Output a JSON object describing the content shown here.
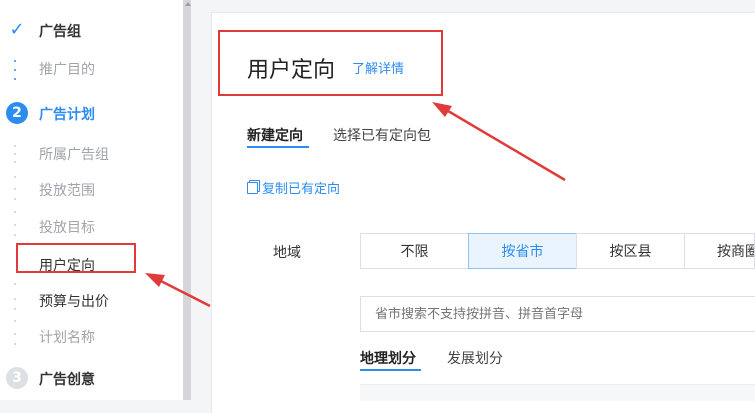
{
  "sidebar": {
    "steps": [
      {
        "label": "广告组",
        "state": "done"
      },
      {
        "label": "推广目的"
      },
      {
        "number": "2",
        "label": "广告计划",
        "state": "active"
      },
      {
        "label": "所属广告组"
      },
      {
        "label": "投放范围"
      },
      {
        "label": "投放目标"
      },
      {
        "label": "用户定向",
        "state": "current"
      },
      {
        "label": "预算与出价"
      },
      {
        "label": "计划名称"
      },
      {
        "number": "3",
        "label": "广告创意",
        "state": "pending"
      }
    ]
  },
  "main": {
    "section_title": "用户定向",
    "details_link": "了解详情",
    "tabs": [
      "新建定向",
      "选择已有定向包"
    ],
    "copy_link": "复制已有定向",
    "region_label": "地域",
    "region_options": [
      "不限",
      "按省市",
      "按区县",
      "按商圈"
    ],
    "search_placeholder": "省市搜索不支持按拼音、拼音首字母",
    "division_tabs": [
      "地理划分",
      "发展划分"
    ]
  },
  "colors": {
    "accent": "#2d8cf0",
    "annotation": "#e03b3b"
  }
}
